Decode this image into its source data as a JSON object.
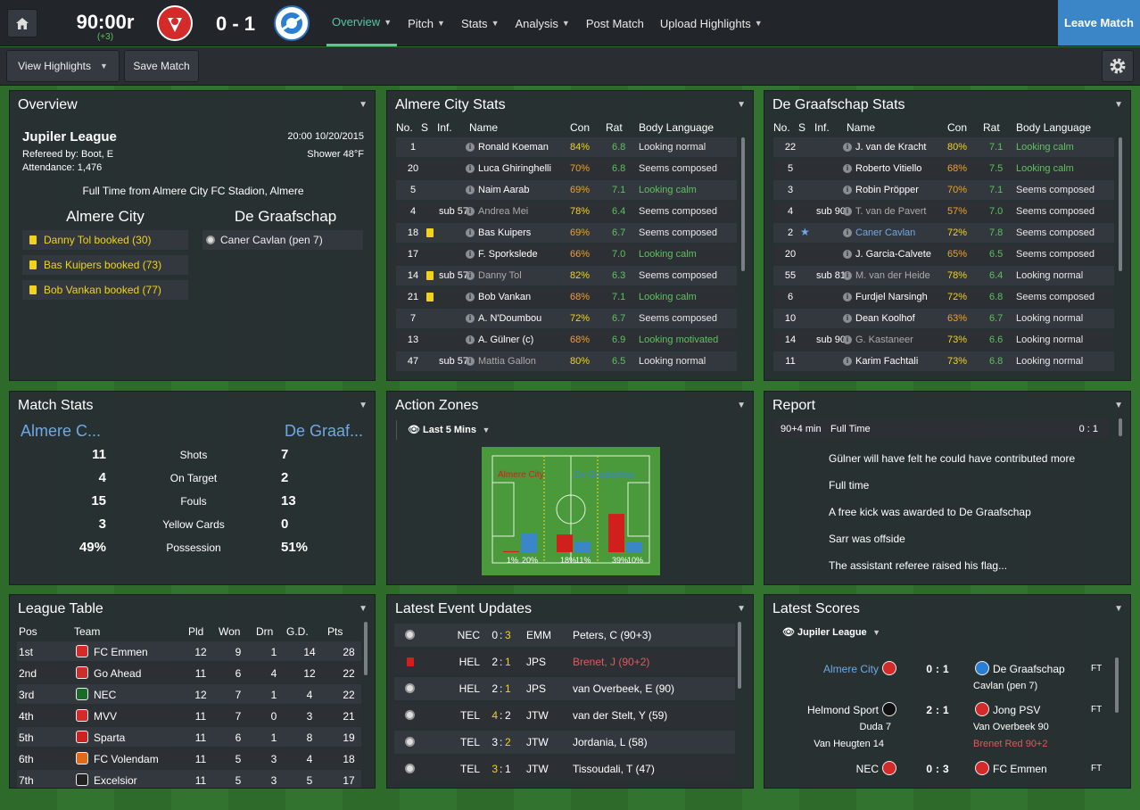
{
  "colors": {
    "accent": "#5bc3a0",
    "positive": "#5bc35b",
    "warning": "#f2d31b",
    "negative": "#d0201e",
    "link": "#6fa8e6"
  },
  "topbar": {
    "home_icon": "home-icon",
    "clock": "90:00r",
    "added_time": "(+3)",
    "score": "0 - 1",
    "home_crest": "almere-city-crest",
    "away_crest": "de-graafschap-crest",
    "nav": [
      {
        "label": "Overview"
      },
      {
        "label": "Pitch"
      },
      {
        "label": "Stats"
      },
      {
        "label": "Analysis"
      },
      {
        "label": "Post Match"
      },
      {
        "label": "Upload Highlights"
      }
    ],
    "leave": "Leave Match"
  },
  "subbar": {
    "view_highlights": "View Highlights",
    "save_match": "Save Match",
    "settings_icon": "gear-icon"
  },
  "overview": {
    "title": "Overview",
    "league": "Jupiler League",
    "datetime": "20:00 10/20/2015",
    "referee": "Refereed by: Boot, E",
    "weather": "Shower 48°F",
    "attendance": "Attendance: 1,476",
    "full_time": "Full Time from Almere City FC Stadion, Almere",
    "home_team": "Almere City",
    "away_team": "De Graafschap",
    "home_events": [
      "Danny Tol booked (30)",
      "Bas Kuipers booked (73)",
      "Bob Vankan booked (77)"
    ],
    "away_events": [
      "Caner Cavlan (pen 7)"
    ]
  },
  "home_stats": {
    "title": "Almere City Stats",
    "headers": [
      "No.",
      "S",
      "Inf.",
      "Name",
      "Con",
      "Rat",
      "Body Language"
    ],
    "rows": [
      {
        "no": "1",
        "inf": "",
        "name": "Ronald Koeman",
        "con": "84%",
        "rat": "6.8",
        "bl": "Looking normal"
      },
      {
        "no": "20",
        "inf": "",
        "name": "Luca Ghiringhelli",
        "con": "70%",
        "rat": "6.8",
        "bl": "Seems composed"
      },
      {
        "no": "5",
        "inf": "",
        "name": "Naim Aarab",
        "con": "69%",
        "rat": "7.1",
        "bl": "Looking calm"
      },
      {
        "no": "4",
        "inf": "sub 57",
        "name": "Andrea Mei",
        "con": "78%",
        "rat": "6.4",
        "bl": "Seems composed"
      },
      {
        "no": "18",
        "inf": "",
        "name": "Bas Kuipers",
        "con": "69%",
        "rat": "6.7",
        "bl": "Seems composed"
      },
      {
        "no": "17",
        "inf": "",
        "name": "F. Sporkslede",
        "con": "66%",
        "rat": "7.0",
        "bl": "Looking calm"
      },
      {
        "no": "14",
        "inf": "sub 57",
        "name": "Danny Tol",
        "con": "82%",
        "rat": "6.3",
        "bl": "Seems composed"
      },
      {
        "no": "21",
        "inf": "",
        "name": "Bob Vankan",
        "con": "68%",
        "rat": "7.1",
        "bl": "Looking calm"
      },
      {
        "no": "7",
        "inf": "",
        "name": "A. N'Doumbou",
        "con": "72%",
        "rat": "6.7",
        "bl": "Seems composed"
      },
      {
        "no": "13",
        "inf": "",
        "name": "A. Gülner (c)",
        "con": "68%",
        "rat": "6.9",
        "bl": "Looking motivated"
      },
      {
        "no": "47",
        "inf": "sub 57",
        "name": "Mattia Gallon",
        "con": "80%",
        "rat": "6.5",
        "bl": "Looking normal"
      }
    ]
  },
  "away_stats": {
    "title": "De Graafschap Stats",
    "headers": [
      "No.",
      "S",
      "Inf.",
      "Name",
      "Con",
      "Rat",
      "Body Language"
    ],
    "rows": [
      {
        "no": "22",
        "inf": "",
        "name": "J. van de Kracht",
        "con": "80%",
        "rat": "7.1",
        "bl": "Looking calm"
      },
      {
        "no": "5",
        "inf": "",
        "name": "Roberto Vitiello",
        "con": "68%",
        "rat": "7.5",
        "bl": "Looking calm"
      },
      {
        "no": "3",
        "inf": "",
        "name": "Robin Pröpper",
        "con": "70%",
        "rat": "7.1",
        "bl": "Seems composed"
      },
      {
        "no": "4",
        "inf": "sub 90",
        "name": "T. van de Pavert",
        "con": "57%",
        "rat": "7.0",
        "bl": "Seems composed"
      },
      {
        "no": "2",
        "inf": "",
        "name": "Caner Cavlan",
        "con": "72%",
        "rat": "7.8",
        "bl": "Seems composed"
      },
      {
        "no": "20",
        "inf": "",
        "name": "J. Garcia-Calvete",
        "con": "65%",
        "rat": "6.5",
        "bl": "Seems composed"
      },
      {
        "no": "55",
        "inf": "sub 81",
        "name": "M. van der Heide",
        "con": "78%",
        "rat": "6.4",
        "bl": "Looking normal"
      },
      {
        "no": "6",
        "inf": "",
        "name": "Furdjel Narsingh",
        "con": "72%",
        "rat": "6.8",
        "bl": "Seems composed"
      },
      {
        "no": "10",
        "inf": "",
        "name": "Dean Koolhof",
        "con": "63%",
        "rat": "6.7",
        "bl": "Looking normal"
      },
      {
        "no": "14",
        "inf": "sub 90",
        "name": "G. Kastaneer",
        "con": "73%",
        "rat": "6.6",
        "bl": "Looking normal"
      },
      {
        "no": "11",
        "inf": "",
        "name": "Karim Fachtali",
        "con": "73%",
        "rat": "6.8",
        "bl": "Looking normal"
      }
    ]
  },
  "match_stats": {
    "title": "Match Stats",
    "home": "Almere C...",
    "away": "De Graaf...",
    "rows": [
      {
        "h": "11",
        "label": "Shots",
        "a": "7"
      },
      {
        "h": "4",
        "label": "On Target",
        "a": "2"
      },
      {
        "h": "15",
        "label": "Fouls",
        "a": "13"
      },
      {
        "h": "3",
        "label": "Yellow Cards",
        "a": "0"
      },
      {
        "h": "49%",
        "label": "Possession",
        "a": "51%"
      }
    ]
  },
  "action_zones": {
    "title": "Action Zones",
    "filter": "Last 5 Mins",
    "home_label": "Almere City",
    "away_label": "De Graafschap",
    "zones": [
      {
        "home": 1,
        "away": 20
      },
      {
        "home": 18,
        "away": 11
      },
      {
        "home": 39,
        "away": 10
      }
    ],
    "zone_labels": [
      {
        "home": "1%",
        "away": "20%"
      },
      {
        "home": "18%",
        "away": "11%"
      },
      {
        "home": "39%",
        "away": "10%"
      }
    ]
  },
  "report": {
    "title": "Report",
    "time": "90+4 min",
    "status": "Full Time",
    "score": "0 : 1",
    "lines": [
      "Gülner will have felt he could have contributed more",
      "Full time",
      "A free kick was awarded to De Graafschap",
      "Sarr was offside",
      "The assistant referee raised his flag..."
    ]
  },
  "league_table": {
    "title": "League Table",
    "headers": [
      "Pos",
      "Team",
      "Pld",
      "Won",
      "Drn",
      "G.D.",
      "Pts"
    ],
    "rows": [
      {
        "pos": "1st",
        "team": "FC Emmen",
        "pld": "12",
        "won": "9",
        "drn": "1",
        "gd": "14",
        "pts": "28"
      },
      {
        "pos": "2nd",
        "team": "Go Ahead",
        "pld": "11",
        "won": "6",
        "drn": "4",
        "gd": "12",
        "pts": "22"
      },
      {
        "pos": "3rd",
        "team": "NEC",
        "pld": "12",
        "won": "7",
        "drn": "1",
        "gd": "4",
        "pts": "22"
      },
      {
        "pos": "4th",
        "team": "MVV",
        "pld": "11",
        "won": "7",
        "drn": "0",
        "gd": "3",
        "pts": "21"
      },
      {
        "pos": "5th",
        "team": "Sparta",
        "pld": "11",
        "won": "6",
        "drn": "1",
        "gd": "8",
        "pts": "19"
      },
      {
        "pos": "6th",
        "team": "FC Volendam",
        "pld": "11",
        "won": "5",
        "drn": "3",
        "gd": "4",
        "pts": "18"
      },
      {
        "pos": "7th",
        "team": "Excelsior",
        "pld": "11",
        "won": "5",
        "drn": "3",
        "gd": "5",
        "pts": "17"
      }
    ]
  },
  "latest_events": {
    "title": "Latest Event Updates",
    "rows": [
      {
        "icon": "goal-icon",
        "home": "NEC",
        "hs": "0",
        "as": "3",
        "away": "EMM",
        "desc": "Peters, C (90+3)",
        "hl": "a"
      },
      {
        "icon": "red-card-icon",
        "home": "HEL",
        "hs": "2",
        "as": "1",
        "away": "JPS",
        "desc": "Brenet, J (90+2)",
        "hl": "a"
      },
      {
        "icon": "goal-icon",
        "home": "HEL",
        "hs": "2",
        "as": "1",
        "away": "JPS",
        "desc": "van Overbeek, E (90)",
        "hl": "a"
      },
      {
        "icon": "goal-icon",
        "home": "TEL",
        "hs": "4",
        "as": "2",
        "away": "JTW",
        "desc": "van der Stelt, Y (59)",
        "hl": "h"
      },
      {
        "icon": "goal-icon",
        "home": "TEL",
        "hs": "3",
        "as": "2",
        "away": "JTW",
        "desc": "Jordania, L (58)",
        "hl": "a"
      },
      {
        "icon": "goal-icon",
        "home": "TEL",
        "hs": "3",
        "as": "1",
        "away": "JTW",
        "desc": "Tissoudali, T (47)",
        "hl": "h"
      }
    ]
  },
  "latest_scores": {
    "title": "Latest Scores",
    "filter": "Jupiler League",
    "sep": ":",
    "matches": [
      {
        "home": "Almere City",
        "hs": "0",
        "as": "1",
        "away": "De Graafschap",
        "status": "FT",
        "away_scorer": "Cavlan (pen 7)",
        "home_scorer": "",
        "away_extra": ""
      },
      {
        "home": "Helmond Sport",
        "hs": "2",
        "as": "1",
        "away": "Jong PSV",
        "status": "FT",
        "home_scorer": "Duda 7",
        "home_scorer2": "Van Heugten 14",
        "away_scorer": "Van Overbeek 90",
        "away_extra": "Brenet Red 90+2"
      },
      {
        "home": "NEC",
        "hs": "0",
        "as": "3",
        "away": "FC Emmen",
        "status": "FT",
        "home_scorer": "",
        "away_scorer": "",
        "away_extra": ""
      }
    ]
  }
}
